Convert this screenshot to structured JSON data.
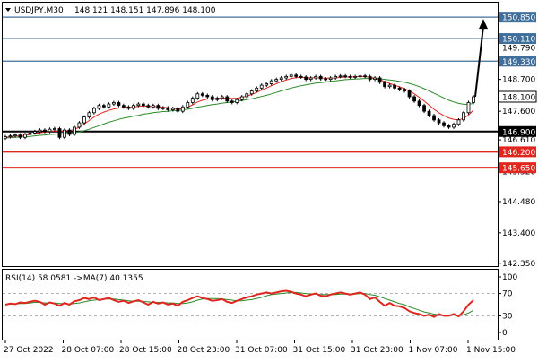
{
  "header": {
    "symbol_label": "USDJPY,M30",
    "ohlc_label": "148.121 148.151 147.896 148.100"
  },
  "colors": {
    "background": "#ffffff",
    "frame": "#000000",
    "blue_level": "#3f6f9a",
    "red_level": "#e0261f",
    "black_level": "#000000",
    "candle": "#000000",
    "ma_fast": "#e0261f",
    "ma_slow": "#2a8a2a",
    "rsi_line": "#e0261f",
    "rsi_ma": "#2a8a2a",
    "tag_blue_bg": "#3f6f9a",
    "tag_red_bg": "#e0261f",
    "tag_black_bg": "#000000",
    "tag_white_bg": "#ffffff"
  },
  "chart_data": {
    "type": "line",
    "instrument": "USDJPY",
    "timeframe": "M30",
    "price_axis_ticks": [
      "148.700",
      "147.600",
      "146.610",
      "145.520",
      "144.480",
      "143.400",
      "142.350"
    ],
    "price_axis_values": [
      148.7,
      147.6,
      146.61,
      145.52,
      144.48,
      143.4,
      142.35
    ],
    "price_ylim": [
      142.25,
      151.35
    ],
    "levels": [
      {
        "label": "150.850",
        "value": 150.85,
        "color": "blue"
      },
      {
        "label": "150.110",
        "value": 150.11,
        "color": "blue"
      },
      {
        "label": "149.330",
        "value": 149.33,
        "color": "blue"
      },
      {
        "label": "146.900",
        "value": 146.9,
        "color": "black"
      },
      {
        "label": "146.200",
        "value": 146.2,
        "color": "red"
      },
      {
        "label": "145.650",
        "value": 145.65,
        "color": "red"
      }
    ],
    "partial_ticks": [
      "149.790",
      "146.610",
      "145.520"
    ],
    "current_price": {
      "label": "148.100",
      "value": 148.1
    },
    "x_tick_labels": [
      "27 Oct 2022",
      "28 Oct 07:00",
      "28 Oct 15:00",
      "28 Oct 23:00",
      "31 Oct 07:00",
      "31 Oct 15:00",
      "31 Oct 23:00",
      "1 Nov 07:00",
      "1 Nov 15:00"
    ],
    "price_series": [
      {
        "name": "price",
        "values": [
          146.72,
          146.75,
          146.78,
          146.7,
          146.8,
          146.85,
          146.9,
          146.95,
          146.9,
          146.98,
          147.0,
          146.7,
          146.95,
          146.8,
          147.05,
          147.2,
          147.4,
          147.55,
          147.7,
          147.8,
          147.75,
          147.85,
          147.9,
          147.8,
          147.75,
          147.7,
          147.8,
          147.85,
          147.8,
          147.75,
          147.8,
          147.7,
          147.72,
          147.65,
          147.7,
          147.6,
          147.75,
          147.9,
          148.05,
          148.2,
          148.15,
          148.1,
          148.0,
          148.05,
          148.1,
          147.95,
          147.9,
          148.0,
          148.1,
          148.2,
          148.3,
          148.4,
          148.5,
          148.55,
          148.65,
          148.7,
          148.75,
          148.8,
          148.85,
          148.8,
          148.78,
          148.7,
          148.75,
          148.8,
          148.72,
          148.7,
          148.75,
          148.8,
          148.82,
          148.8,
          148.78,
          148.8,
          148.82,
          148.8,
          148.7,
          148.75,
          148.6,
          148.45,
          148.5,
          148.4,
          148.35,
          148.3,
          148.1,
          147.95,
          147.8,
          147.6,
          147.45,
          147.3,
          147.2,
          147.1,
          147.05,
          147.15,
          147.3,
          147.55,
          147.9,
          148.1
        ]
      },
      {
        "name": "ma_fast",
        "values": [
          146.7,
          146.72,
          146.74,
          146.75,
          146.77,
          146.8,
          146.83,
          146.86,
          146.88,
          146.9,
          146.92,
          146.9,
          146.92,
          146.93,
          146.97,
          147.05,
          147.16,
          147.28,
          147.4,
          147.5,
          147.57,
          147.63,
          147.68,
          147.71,
          147.73,
          147.73,
          147.75,
          147.77,
          147.78,
          147.77,
          147.77,
          147.75,
          147.74,
          147.72,
          147.7,
          147.68,
          147.69,
          147.74,
          147.82,
          147.92,
          147.98,
          148.02,
          148.03,
          148.04,
          148.06,
          148.05,
          148.04,
          148.05,
          148.08,
          148.12,
          148.18,
          148.25,
          148.33,
          148.4,
          148.48,
          148.55,
          148.62,
          148.68,
          148.73,
          148.76,
          148.77,
          148.76,
          148.75,
          148.76,
          148.75,
          148.74,
          148.74,
          148.75,
          148.77,
          148.78,
          148.78,
          148.79,
          148.8,
          148.8,
          148.77,
          148.74,
          148.69,
          148.62,
          148.56,
          148.5,
          148.44,
          148.38,
          148.3,
          148.2,
          148.08,
          147.95,
          147.81,
          147.67,
          147.55,
          147.45,
          147.37,
          147.32,
          147.3,
          147.35,
          147.47,
          147.64
        ]
      },
      {
        "name": "ma_slow",
        "values": [
          146.68,
          146.69,
          146.7,
          146.71,
          146.72,
          146.73,
          146.75,
          146.77,
          146.78,
          146.8,
          146.81,
          146.82,
          146.83,
          146.84,
          146.86,
          146.89,
          146.93,
          146.98,
          147.04,
          147.1,
          147.16,
          147.22,
          147.27,
          147.32,
          147.36,
          147.39,
          147.43,
          147.46,
          147.5,
          147.52,
          147.55,
          147.57,
          147.59,
          147.6,
          147.62,
          147.63,
          147.65,
          147.67,
          147.7,
          147.74,
          147.77,
          147.8,
          147.83,
          147.85,
          147.88,
          147.9,
          147.92,
          147.94,
          147.97,
          148.0,
          148.03,
          148.07,
          148.11,
          148.15,
          148.2,
          148.25,
          148.3,
          148.35,
          148.4,
          148.44,
          148.48,
          148.51,
          148.54,
          148.57,
          148.59,
          148.61,
          148.63,
          148.65,
          148.67,
          148.69,
          148.7,
          148.71,
          148.72,
          148.73,
          148.73,
          148.73,
          148.72,
          148.7,
          148.68,
          148.66,
          148.63,
          148.6,
          148.56,
          148.51,
          148.45,
          148.38,
          148.3,
          148.22,
          148.14,
          148.06,
          147.98,
          147.92,
          147.87,
          147.84,
          147.84,
          147.87
        ]
      }
    ],
    "rsi": {
      "label": "RSI(14) 58.0581 ->MA(7) 40.1355",
      "ticks": [
        "100",
        "70",
        "30",
        "0"
      ],
      "tick_values": [
        100,
        70,
        30,
        0
      ],
      "ylim": [
        0,
        100
      ],
      "levels": [
        70,
        30
      ],
      "series": [
        {
          "name": "rsi",
          "values": [
            50,
            52,
            51,
            54,
            53,
            55,
            57,
            55,
            50,
            54,
            52,
            48,
            53,
            50,
            56,
            58,
            62,
            60,
            63,
            58,
            60,
            62,
            58,
            55,
            57,
            53,
            56,
            58,
            54,
            50,
            55,
            52,
            54,
            50,
            52,
            48,
            55,
            58,
            62,
            65,
            62,
            60,
            57,
            58,
            60,
            55,
            53,
            57,
            60,
            63,
            65,
            68,
            70,
            72,
            70,
            72,
            74,
            75,
            73,
            70,
            68,
            65,
            68,
            70,
            66,
            65,
            68,
            70,
            72,
            70,
            68,
            70,
            72,
            68,
            60,
            63,
            55,
            48,
            53,
            48,
            47,
            44,
            38,
            35,
            33,
            30,
            32,
            28,
            33,
            30,
            30,
            33,
            29,
            38,
            50,
            58
          ]
        },
        {
          "name": "rsi_ma",
          "values": [
            50,
            51,
            51,
            52,
            52,
            53,
            54,
            54,
            53,
            53,
            53,
            52,
            52,
            51,
            52,
            53,
            55,
            57,
            58,
            59,
            60,
            60,
            60,
            59,
            58,
            57,
            56,
            56,
            56,
            55,
            54,
            54,
            54,
            53,
            53,
            52,
            52,
            53,
            55,
            58,
            60,
            61,
            61,
            61,
            60,
            59,
            58,
            57,
            57,
            58,
            59,
            61,
            63,
            66,
            68,
            69,
            70,
            71,
            72,
            72,
            71,
            70,
            69,
            69,
            68,
            68,
            68,
            68,
            69,
            69,
            69,
            69,
            70,
            70,
            68,
            67,
            64,
            61,
            58,
            55,
            52,
            50,
            46,
            43,
            40,
            37,
            35,
            33,
            32,
            31,
            31,
            31,
            31,
            32,
            35,
            40
          ]
        }
      ]
    }
  }
}
